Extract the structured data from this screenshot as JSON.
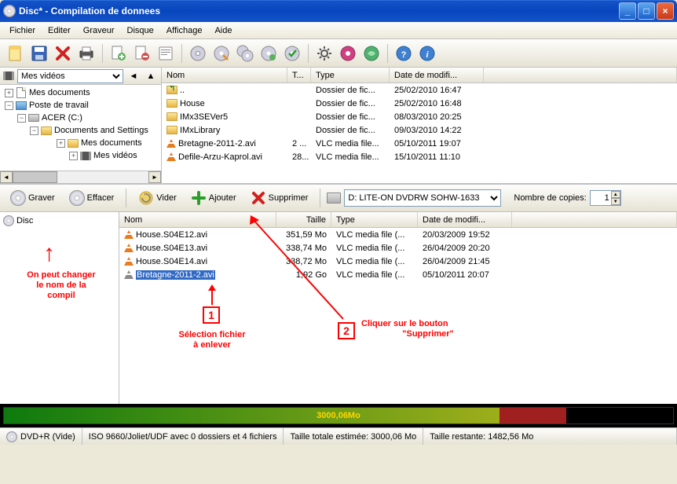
{
  "window": {
    "title": "Disc* - Compilation de donnees"
  },
  "menu": {
    "file": "Fichier",
    "edit": "Editer",
    "recorder": "Graveur",
    "disc": "Disque",
    "view": "Affichage",
    "help": "Aide"
  },
  "tree_header": {
    "selected": "Mes vidéos"
  },
  "tree": {
    "n0": "Mes documents",
    "n1": "Poste de travail",
    "n2": "ACER (C:)",
    "n3": "Documents and Settings",
    "n4": "Mes documents",
    "n5": "Mes vidéos"
  },
  "upper_cols": {
    "name": "Nom",
    "size": "T...",
    "type": "Type",
    "date": "Date de modifi..."
  },
  "upper_rows": [
    {
      "name": "..",
      "size": "",
      "type": "Dossier de fic...",
      "date": "25/02/2010 16:47",
      "ico": "folder-up"
    },
    {
      "name": "House",
      "size": "",
      "type": "Dossier de fic...",
      "date": "25/02/2010 16:48",
      "ico": "folder"
    },
    {
      "name": "IMx3SEVer5",
      "size": "",
      "type": "Dossier de fic...",
      "date": "08/03/2010 20:25",
      "ico": "folder"
    },
    {
      "name": "IMxLibrary",
      "size": "",
      "type": "Dossier de fic...",
      "date": "09/03/2010 14:22",
      "ico": "folder"
    },
    {
      "name": "Bretagne-2011-2.avi",
      "size": "2 ...",
      "type": "VLC media file...",
      "date": "05/10/2011 19:07",
      "ico": "vlc"
    },
    {
      "name": "Defile-Arzu-Kaprol.avi",
      "size": "28...",
      "type": "VLC media file...",
      "date": "15/10/2011 11:10",
      "ico": "vlc"
    }
  ],
  "mid": {
    "burn": "Graver",
    "erase": "Effacer",
    "empty": "Vider",
    "add": "Ajouter",
    "remove": "Supprimer",
    "drive": "D: LITE-ON DVDRW SOHW-1633",
    "copies_label": "Nombre de copies:",
    "copies_value": "1"
  },
  "disc_tree": {
    "root": "Disc"
  },
  "lower_cols": {
    "name": "Nom",
    "size": "Taille",
    "type": "Type",
    "date": "Date de modifi..."
  },
  "lower_rows": [
    {
      "name": "House.S04E12.avi",
      "size": "351,59 Mo",
      "type": "VLC media file (...",
      "date": "20/03/2009 19:52",
      "ico": "vlc",
      "sel": false
    },
    {
      "name": "House.S04E13.avi",
      "size": "338,74 Mo",
      "type": "VLC media file (...",
      "date": "26/04/2009 20:20",
      "ico": "vlc",
      "sel": false
    },
    {
      "name": "House.S04E14.avi",
      "size": "338,72 Mo",
      "type": "VLC media file (...",
      "date": "26/04/2009 21:45",
      "ico": "vlc",
      "sel": false
    },
    {
      "name": "Bretagne-2011-2.avi",
      "size": "1,92 Go",
      "type": "VLC media file (...",
      "date": "05/10/2011 20:07",
      "ico": "vlc-gray",
      "sel": true
    }
  ],
  "progress": {
    "label": "3000,06Mo"
  },
  "status": {
    "panel1": "DVD+R (Vide)",
    "panel2": "ISO 9660/Joliet/UDF avec 0 dossiers et 4 fichiers",
    "panel3": "Taille totale estimée:  3000,06 Mo",
    "panel4": "Taille restante:  1482,56 Mo"
  },
  "annotations": {
    "a1_l1": "On peut changer",
    "a1_l2": "le nom de la",
    "a1_l3": "compil",
    "n1": "1",
    "a2_l1": "Sélection fichier",
    "a2_l2": "à enlever",
    "n2": "2",
    "a3_l1": "Cliquer sur le bouton",
    "a3_l2": "\"Supprimer\""
  }
}
